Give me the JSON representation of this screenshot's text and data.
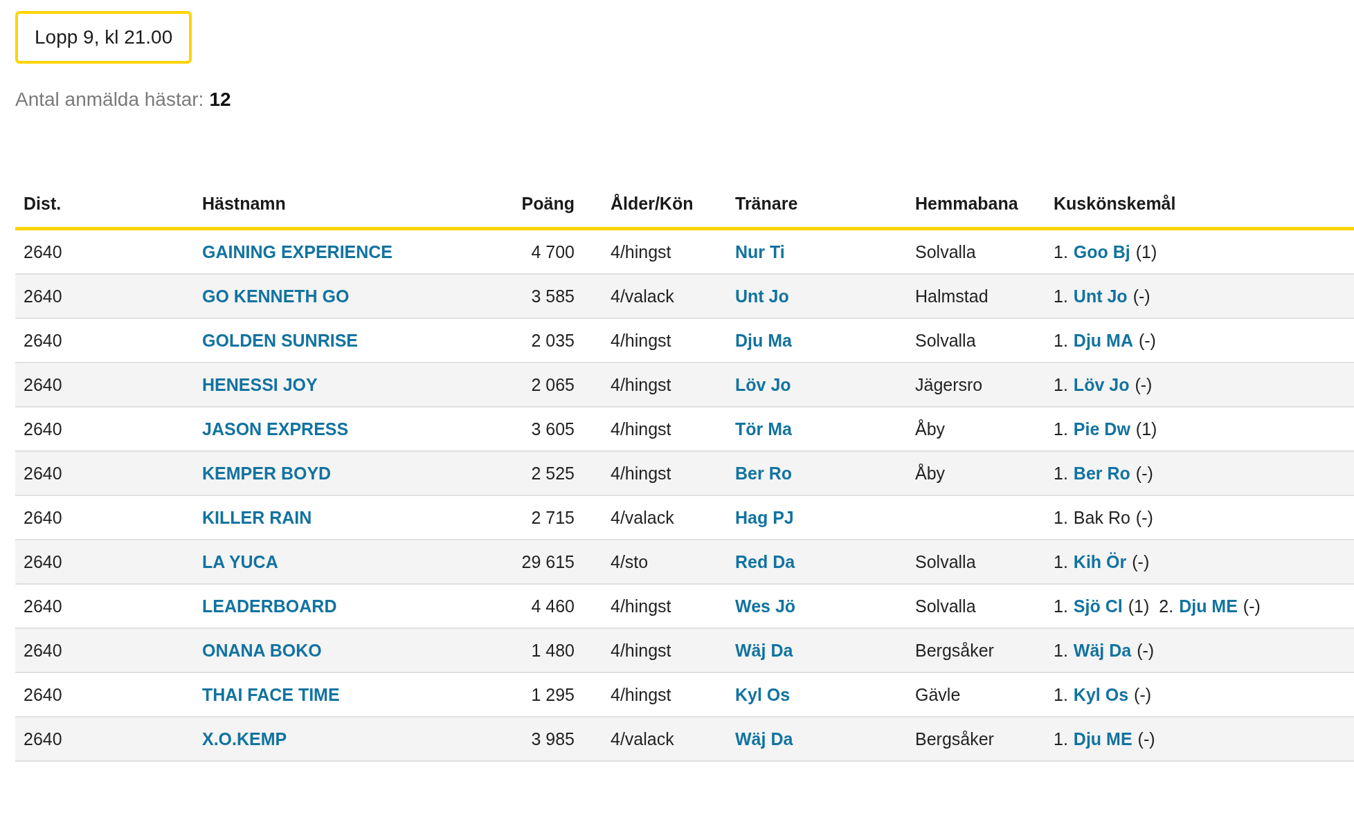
{
  "race_title": "Lopp 9, kl 21.00",
  "entries_summary": {
    "label": "Antal anmälda hästar:",
    "count": "12"
  },
  "table": {
    "columns": [
      "Dist.",
      "Hästnamn",
      "Poäng",
      "Ålder/Kön",
      "Tränare",
      "Hemmabana",
      "Kuskönskemål"
    ],
    "rows": [
      {
        "dist": "2640",
        "horse": "GAINING EXPERIENCE",
        "points": "4 700",
        "age_sex": "4/hingst",
        "trainer": "Nur Ti",
        "home_track": "Solvalla",
        "drivers": [
          {
            "rank": "1.",
            "name": "Goo Bj",
            "linked": true,
            "note": "(1)"
          }
        ]
      },
      {
        "dist": "2640",
        "horse": "GO KENNETH GO",
        "points": "3 585",
        "age_sex": "4/valack",
        "trainer": "Unt Jo",
        "home_track": "Halmstad",
        "drivers": [
          {
            "rank": "1.",
            "name": "Unt Jo",
            "linked": true,
            "note": "(-)"
          }
        ]
      },
      {
        "dist": "2640",
        "horse": "GOLDEN SUNRISE",
        "points": "2 035",
        "age_sex": "4/hingst",
        "trainer": "Dju Ma",
        "home_track": "Solvalla",
        "drivers": [
          {
            "rank": "1.",
            "name": "Dju MA",
            "linked": true,
            "note": "(-)"
          }
        ]
      },
      {
        "dist": "2640",
        "horse": "HENESSI JOY",
        "points": "2 065",
        "age_sex": "4/hingst",
        "trainer": "Löv Jo",
        "home_track": "Jägersro",
        "drivers": [
          {
            "rank": "1.",
            "name": "Löv Jo",
            "linked": true,
            "note": "(-)"
          }
        ]
      },
      {
        "dist": "2640",
        "horse": "JASON EXPRESS",
        "points": "3 605",
        "age_sex": "4/hingst",
        "trainer": "Tör Ma",
        "home_track": "Åby",
        "drivers": [
          {
            "rank": "1.",
            "name": "Pie Dw",
            "linked": true,
            "note": "(1)"
          }
        ]
      },
      {
        "dist": "2640",
        "horse": "KEMPER BOYD",
        "points": "2 525",
        "age_sex": "4/hingst",
        "trainer": "Ber Ro",
        "home_track": "Åby",
        "drivers": [
          {
            "rank": "1.",
            "name": "Ber Ro",
            "linked": true,
            "note": "(-)"
          }
        ]
      },
      {
        "dist": "2640",
        "horse": "KILLER RAIN",
        "points": "2 715",
        "age_sex": "4/valack",
        "trainer": "Hag PJ",
        "drivers": [
          {
            "rank": "1.",
            "name": "Bak Ro",
            "linked": false,
            "note": "(-)"
          }
        ]
      },
      {
        "dist": "2640",
        "horse": "LA YUCA",
        "points": "29 615",
        "age_sex": "4/sto",
        "trainer": "Red Da",
        "home_track": "Solvalla",
        "drivers": [
          {
            "rank": "1.",
            "name": "Kih Ör",
            "linked": true,
            "note": "(-)"
          }
        ]
      },
      {
        "dist": "2640",
        "horse": "LEADERBOARD",
        "points": "4 460",
        "age_sex": "4/hingst",
        "trainer": "Wes Jö",
        "home_track": "Solvalla",
        "drivers": [
          {
            "rank": "1.",
            "name": "Sjö Cl",
            "linked": true,
            "note": "(1)"
          },
          {
            "rank": "2.",
            "name": "Dju ME",
            "linked": true,
            "note": "(-)"
          }
        ]
      },
      {
        "dist": "2640",
        "horse": "ONANA BOKO",
        "points": "1 480",
        "age_sex": "4/hingst",
        "trainer": "Wäj Da",
        "home_track": "Bergsåker",
        "drivers": [
          {
            "rank": "1.",
            "name": "Wäj Da",
            "linked": true,
            "note": "(-)"
          }
        ]
      },
      {
        "dist": "2640",
        "horse": "THAI FACE TIME",
        "points": "1 295",
        "age_sex": "4/hingst",
        "trainer": "Kyl Os",
        "home_track": "Gävle",
        "drivers": [
          {
            "rank": "1.",
            "name": "Kyl Os",
            "linked": true,
            "note": "(-)"
          }
        ]
      },
      {
        "dist": "2640",
        "horse": "X.O.KEMP",
        "points": "3 985",
        "age_sex": "4/valack",
        "trainer": "Wäj Da",
        "home_track": "Bergsåker",
        "drivers": [
          {
            "rank": "1.",
            "name": "Dju ME",
            "linked": true,
            "note": "(-)"
          }
        ]
      }
    ]
  }
}
